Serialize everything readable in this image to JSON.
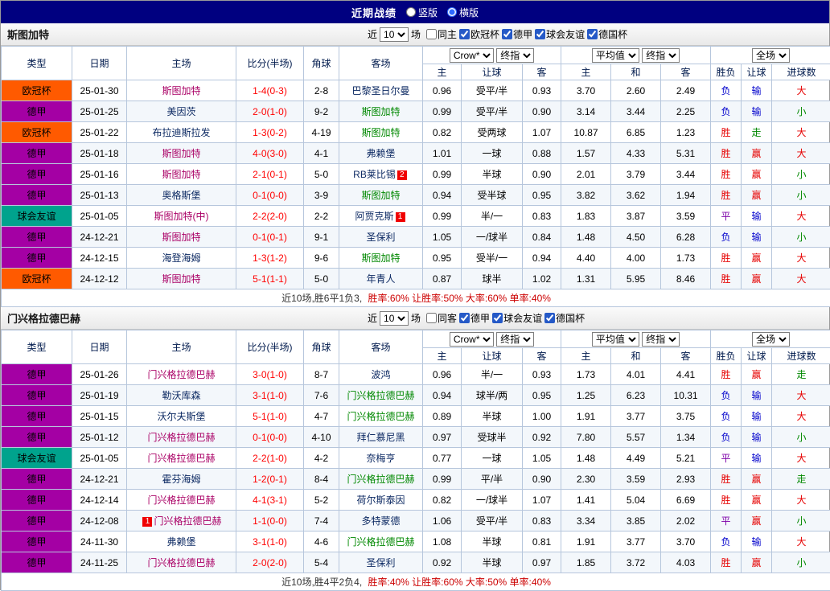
{
  "topbar": {
    "title": "近期战绩",
    "layout_options": [
      {
        "label": "竖版",
        "selected": false
      },
      {
        "label": "横版",
        "selected": true
      }
    ]
  },
  "colors": {
    "competition": {
      "欧冠杯": "#ff5a00",
      "德甲": "#a400a4",
      "球会友谊": "#00a38d"
    },
    "result": {
      "胜": "#e60000",
      "平": "#7d00a8",
      "负": "#0000cc",
      "赢": "#e60000",
      "输": "#0000cc",
      "走": "#008800",
      "大": "#e60000",
      "小": "#008800"
    },
    "focal_home": "#aa0066",
    "focal_away": "#008800",
    "opponent": "#0d2a63",
    "score": "#ff0000"
  },
  "table_header": {
    "type": "类型",
    "date": "日期",
    "home": "主场",
    "score": "比分(半场)",
    "corner": "角球",
    "away": "客场",
    "odds_group": {
      "bookmaker": "Crow*",
      "odds_stage": "终指",
      "sub": [
        "主",
        "让球",
        "客"
      ]
    },
    "avg_group": {
      "name": "平均值",
      "odds_stage": "终指",
      "sub": [
        "主",
        "和",
        "客"
      ]
    },
    "result_group": {
      "scope": "全场",
      "sub": [
        "胜负",
        "让球",
        "进球数"
      ]
    }
  },
  "sections": [
    {
      "team": "斯图加特",
      "filter": {
        "near": "近",
        "count": "10",
        "games": "场",
        "options": [
          {
            "label": "同主",
            "checked": false
          },
          {
            "label": "欧冠杯",
            "checked": true
          },
          {
            "label": "德甲",
            "checked": true
          },
          {
            "label": "球会友谊",
            "checked": true
          },
          {
            "label": "德国杯",
            "checked": true
          }
        ]
      },
      "rows": [
        {
          "comp": "欧冠杯",
          "date": "25-01-30",
          "home": "斯图加特",
          "away": "巴黎圣日尔曼",
          "focal": "home",
          "score": "1-4(0-3)",
          "corner": "2-8",
          "odds": [
            "0.96",
            "受平/半",
            "0.93"
          ],
          "avg": [
            "3.70",
            "2.60",
            "2.49"
          ],
          "results": [
            "负",
            "输",
            "大"
          ]
        },
        {
          "comp": "德甲",
          "date": "25-01-25",
          "home": "美因茨",
          "away": "斯图加特",
          "focal": "away",
          "score": "2-0(1-0)",
          "corner": "9-2",
          "odds": [
            "0.99",
            "受平/半",
            "0.90"
          ],
          "avg": [
            "3.14",
            "3.44",
            "2.25"
          ],
          "results": [
            "负",
            "输",
            "小"
          ]
        },
        {
          "comp": "欧冠杯",
          "date": "25-01-22",
          "home": "布拉迪斯拉发",
          "away": "斯图加特",
          "focal": "away",
          "score": "1-3(0-2)",
          "corner": "4-19",
          "odds": [
            "0.82",
            "受两球",
            "1.07"
          ],
          "avg": [
            "10.87",
            "6.85",
            "1.23"
          ],
          "results": [
            "胜",
            "走",
            "大"
          ]
        },
        {
          "comp": "德甲",
          "date": "25-01-18",
          "home": "斯图加特",
          "away": "弗赖堡",
          "focal": "home",
          "score": "4-0(3-0)",
          "corner": "4-1",
          "odds": [
            "1.01",
            "一球",
            "0.88"
          ],
          "avg": [
            "1.57",
            "4.33",
            "5.31"
          ],
          "results": [
            "胜",
            "赢",
            "大"
          ]
        },
        {
          "comp": "德甲",
          "date": "25-01-16",
          "home": "斯图加特",
          "away": "RB莱比锡",
          "away_badge": "2",
          "focal": "home",
          "score": "2-1(0-1)",
          "corner": "5-0",
          "odds": [
            "0.99",
            "半球",
            "0.90"
          ],
          "avg": [
            "2.01",
            "3.79",
            "3.44"
          ],
          "results": [
            "胜",
            "赢",
            "小"
          ]
        },
        {
          "comp": "德甲",
          "date": "25-01-13",
          "home": "奥格斯堡",
          "away": "斯图加特",
          "focal": "away",
          "score": "0-1(0-0)",
          "corner": "3-9",
          "odds": [
            "0.94",
            "受半球",
            "0.95"
          ],
          "avg": [
            "3.82",
            "3.62",
            "1.94"
          ],
          "results": [
            "胜",
            "赢",
            "小"
          ]
        },
        {
          "comp": "球会友谊",
          "date": "25-01-05",
          "home": "斯图加特(中)",
          "away": "阿贾克斯",
          "away_badge": "1",
          "focal": "home",
          "score": "2-2(2-0)",
          "corner": "2-2",
          "odds": [
            "0.99",
            "半/一",
            "0.83"
          ],
          "avg": [
            "1.83",
            "3.87",
            "3.59"
          ],
          "results": [
            "平",
            "输",
            "大"
          ]
        },
        {
          "comp": "德甲",
          "date": "24-12-21",
          "home": "斯图加特",
          "away": "圣保利",
          "focal": "home",
          "score": "0-1(0-1)",
          "corner": "9-1",
          "odds": [
            "1.05",
            "一/球半",
            "0.84"
          ],
          "avg": [
            "1.48",
            "4.50",
            "6.28"
          ],
          "results": [
            "负",
            "输",
            "小"
          ]
        },
        {
          "comp": "德甲",
          "date": "24-12-15",
          "home": "海登海姆",
          "away": "斯图加特",
          "focal": "away",
          "score": "1-3(1-2)",
          "corner": "9-6",
          "odds": [
            "0.95",
            "受半/一",
            "0.94"
          ],
          "avg": [
            "4.40",
            "4.00",
            "1.73"
          ],
          "results": [
            "胜",
            "赢",
            "大"
          ]
        },
        {
          "comp": "欧冠杯",
          "date": "24-12-12",
          "home": "斯图加特",
          "away": "年青人",
          "focal": "home",
          "score": "5-1(1-1)",
          "corner": "5-0",
          "odds": [
            "0.87",
            "球半",
            "1.02"
          ],
          "avg": [
            "1.31",
            "5.95",
            "8.46"
          ],
          "results": [
            "胜",
            "赢",
            "大"
          ]
        }
      ],
      "summary": {
        "record": "近10场,胜6平1负3,",
        "rates": "胜率:60% 让胜率:50% 大率:60% 单率:40%"
      }
    },
    {
      "team": "门兴格拉德巴赫",
      "filter": {
        "near": "近",
        "count": "10",
        "games": "场",
        "options": [
          {
            "label": "同客",
            "checked": false
          },
          {
            "label": "德甲",
            "checked": true
          },
          {
            "label": "球会友谊",
            "checked": true
          },
          {
            "label": "德国杯",
            "checked": true
          }
        ]
      },
      "rows": [
        {
          "comp": "德甲",
          "date": "25-01-26",
          "home": "门兴格拉德巴赫",
          "away": "波鸿",
          "focal": "home",
          "score": "3-0(1-0)",
          "corner": "8-7",
          "odds": [
            "0.96",
            "半/一",
            "0.93"
          ],
          "avg": [
            "1.73",
            "4.01",
            "4.41"
          ],
          "results": [
            "胜",
            "赢",
            "走"
          ]
        },
        {
          "comp": "德甲",
          "date": "25-01-19",
          "home": "勒沃库森",
          "away": "门兴格拉德巴赫",
          "focal": "away",
          "score": "3-1(1-0)",
          "corner": "7-6",
          "odds": [
            "0.94",
            "球半/两",
            "0.95"
          ],
          "avg": [
            "1.25",
            "6.23",
            "10.31"
          ],
          "results": [
            "负",
            "输",
            "大"
          ]
        },
        {
          "comp": "德甲",
          "date": "25-01-15",
          "home": "沃尔夫斯堡",
          "away": "门兴格拉德巴赫",
          "focal": "away",
          "score": "5-1(1-0)",
          "corner": "4-7",
          "odds": [
            "0.89",
            "半球",
            "1.00"
          ],
          "avg": [
            "1.91",
            "3.77",
            "3.75"
          ],
          "results": [
            "负",
            "输",
            "大"
          ]
        },
        {
          "comp": "德甲",
          "date": "25-01-12",
          "home": "门兴格拉德巴赫",
          "away": "拜仁慕尼黑",
          "focal": "home",
          "score": "0-1(0-0)",
          "corner": "4-10",
          "odds": [
            "0.97",
            "受球半",
            "0.92"
          ],
          "avg": [
            "7.80",
            "5.57",
            "1.34"
          ],
          "results": [
            "负",
            "输",
            "小"
          ]
        },
        {
          "comp": "球会友谊",
          "date": "25-01-05",
          "home": "门兴格拉德巴赫",
          "away": "奈梅亨",
          "focal": "home",
          "score": "2-2(1-0)",
          "corner": "4-2",
          "odds": [
            "0.77",
            "一球",
            "1.05"
          ],
          "avg": [
            "1.48",
            "4.49",
            "5.21"
          ],
          "results": [
            "平",
            "输",
            "大"
          ]
        },
        {
          "comp": "德甲",
          "date": "24-12-21",
          "home": "霍芬海姆",
          "away": "门兴格拉德巴赫",
          "focal": "away",
          "score": "1-2(0-1)",
          "corner": "8-4",
          "odds": [
            "0.99",
            "平/半",
            "0.90"
          ],
          "avg": [
            "2.30",
            "3.59",
            "2.93"
          ],
          "results": [
            "胜",
            "赢",
            "走"
          ]
        },
        {
          "comp": "德甲",
          "date": "24-12-14",
          "home": "门兴格拉德巴赫",
          "away": "荷尔斯泰因",
          "focal": "home",
          "score": "4-1(3-1)",
          "corner": "5-2",
          "odds": [
            "0.82",
            "一/球半",
            "1.07"
          ],
          "avg": [
            "1.41",
            "5.04",
            "6.69"
          ],
          "results": [
            "胜",
            "赢",
            "大"
          ]
        },
        {
          "comp": "德甲",
          "date": "24-12-08",
          "home": "门兴格拉德巴赫",
          "home_badge": "1",
          "away": "多特蒙德",
          "focal": "home",
          "score": "1-1(0-0)",
          "corner": "7-4",
          "odds": [
            "1.06",
            "受平/半",
            "0.83"
          ],
          "avg": [
            "3.34",
            "3.85",
            "2.02"
          ],
          "results": [
            "平",
            "赢",
            "小"
          ]
        },
        {
          "comp": "德甲",
          "date": "24-11-30",
          "home": "弗赖堡",
          "away": "门兴格拉德巴赫",
          "focal": "away",
          "score": "3-1(1-0)",
          "corner": "4-6",
          "odds": [
            "1.08",
            "半球",
            "0.81"
          ],
          "avg": [
            "1.91",
            "3.77",
            "3.70"
          ],
          "results": [
            "负",
            "输",
            "大"
          ]
        },
        {
          "comp": "德甲",
          "date": "24-11-25",
          "home": "门兴格拉德巴赫",
          "away": "圣保利",
          "focal": "home",
          "score": "2-0(2-0)",
          "corner": "5-4",
          "odds": [
            "0.92",
            "半球",
            "0.97"
          ],
          "avg": [
            "1.85",
            "3.72",
            "4.03"
          ],
          "results": [
            "胜",
            "赢",
            "小"
          ]
        }
      ],
      "summary": {
        "record": "近10场,胜4平2负4,",
        "rates": "胜率:40% 让胜率:60% 大率:50% 单率:40%"
      }
    }
  ]
}
